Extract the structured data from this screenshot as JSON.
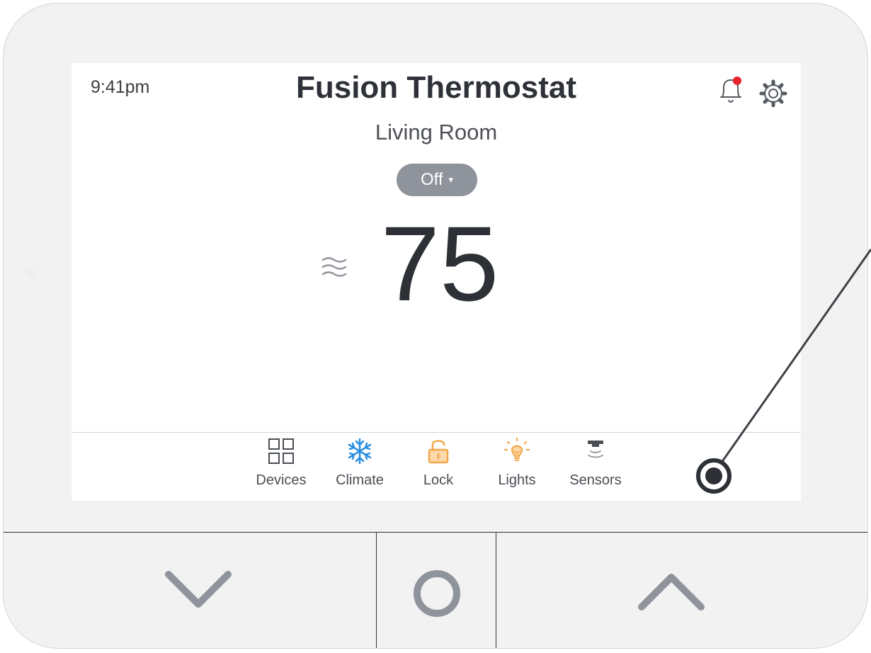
{
  "header": {
    "time": "9:41pm",
    "title": "Fusion Thermostat",
    "room": "Living Room"
  },
  "mode": {
    "label": "Off",
    "caret": "▾"
  },
  "temperature": {
    "value": "75"
  },
  "icons": {
    "notification": "bell-icon",
    "notification_badge_color": "#e8232d",
    "settings": "gear-icon",
    "fan": "fan-waves-icon"
  },
  "nav": {
    "items": [
      {
        "label": "Devices",
        "icon": "grid-icon",
        "color": "#4a4e55"
      },
      {
        "label": "Climate",
        "icon": "snowflake-icon",
        "color": "#2a8ee0"
      },
      {
        "label": "Lock",
        "icon": "lock-icon",
        "color": "#f3a64a"
      },
      {
        "label": "Lights",
        "icon": "lightbulb-icon",
        "color": "#f3a64a"
      },
      {
        "label": "Sensors",
        "icon": "sensor-icon",
        "color": "#8f939b"
      }
    ]
  },
  "hardware_buttons": [
    {
      "name": "down",
      "icon": "chevron-down-icon"
    },
    {
      "name": "home",
      "icon": "circle-icon"
    },
    {
      "name": "up",
      "icon": "chevron-up-icon"
    }
  ]
}
